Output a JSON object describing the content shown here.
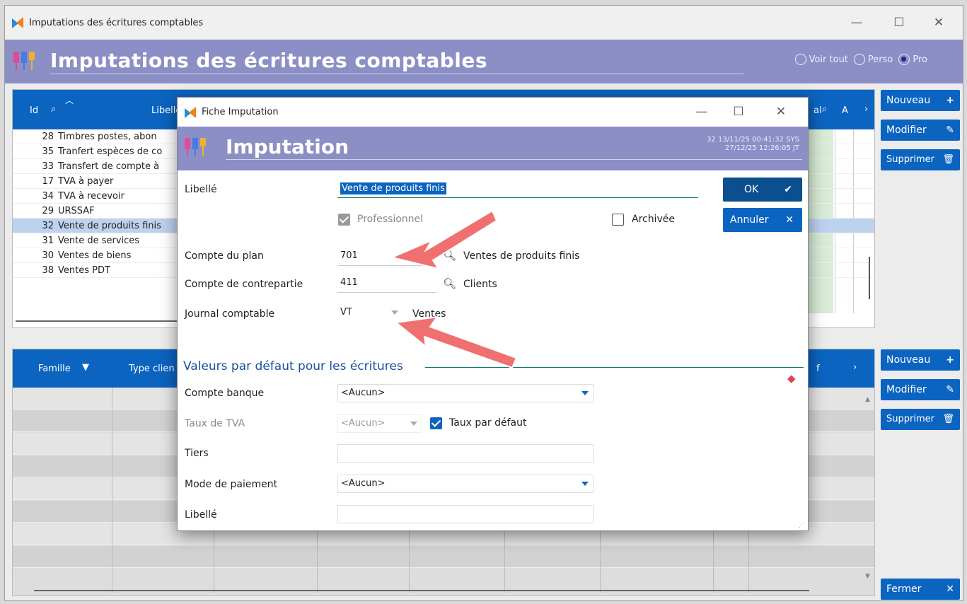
{
  "window": {
    "title": "Imputations des écritures comptables"
  },
  "header": {
    "title": "Imputations des écritures comptables"
  },
  "view": {
    "options": [
      "Voir tout",
      "Perso",
      "Pro"
    ],
    "selected": "Pro"
  },
  "top_grid": {
    "headers": {
      "id": "Id",
      "label": "Libellé",
      "extra": "al",
      "extra2": "A"
    },
    "rows": [
      {
        "id": "28",
        "label": "Timbres postes, abon"
      },
      {
        "id": "35",
        "label": "Tranfert espèces de co"
      },
      {
        "id": "33",
        "label": "Transfert de compte à"
      },
      {
        "id": "17",
        "label": "TVA à payer"
      },
      {
        "id": "34",
        "label": "TVA à recevoir"
      },
      {
        "id": "29",
        "label": "URSSAF"
      },
      {
        "id": "32",
        "label": "Vente de produits finis"
      },
      {
        "id": "31",
        "label": "Vente de services"
      },
      {
        "id": "30",
        "label": "Ventes de biens"
      },
      {
        "id": "38",
        "label": "Ventes PDT"
      }
    ],
    "selected_id": "32"
  },
  "top_buttons": {
    "new": "Nouveau",
    "edit": "Modifier",
    "delete": "Supprimer"
  },
  "bottom_grid": {
    "headers": {
      "family": "Famille",
      "client_type": "Type clien",
      "extra": "f"
    }
  },
  "bottom_buttons": {
    "new": "Nouveau",
    "edit": "Modifier",
    "delete": "Supprimer",
    "close": "Fermer"
  },
  "dialog": {
    "title": "Fiche Imputation",
    "header": "Imputation",
    "meta_line1": "32  13/11/25 00:41:32 SYS",
    "meta_line2": "27/12/25 12:26:05 JT",
    "libelle_label": "Libellé",
    "libelle_value": "Vente de produits finis",
    "professionnel_label": "Professionnel",
    "archivee_label": "Archivée",
    "ok_label": "OK",
    "cancel_label": "Annuler",
    "compte_plan_label": "Compte du plan",
    "compte_plan_value": "701",
    "compte_plan_desc": "Ventes de produits finis",
    "contrepartie_label": "Compte de contrepartie",
    "contrepartie_value": "411",
    "contrepartie_desc": "Clients",
    "journal_label": "Journal comptable",
    "journal_value": "VT",
    "journal_desc": "Ventes",
    "section_title": "Valeurs par défaut pour les écritures",
    "banque_label": "Compte banque",
    "banque_value": "<Aucun>",
    "tva_label": "Taux de TVA",
    "tva_value": "<Aucun>",
    "taux_defaut_label": "Taux par défaut",
    "tiers_label": "Tiers",
    "tiers_value": "",
    "paiement_label": "Mode de paiement",
    "paiement_value": "<Aucun>",
    "libelle2_label": "Libellé",
    "libelle2_value": ""
  },
  "colors": {
    "accent": "#0b64c0",
    "header": "#8b8fc6",
    "selected_row": "#bdd2ee",
    "annotation_arrow": "#f07070"
  }
}
